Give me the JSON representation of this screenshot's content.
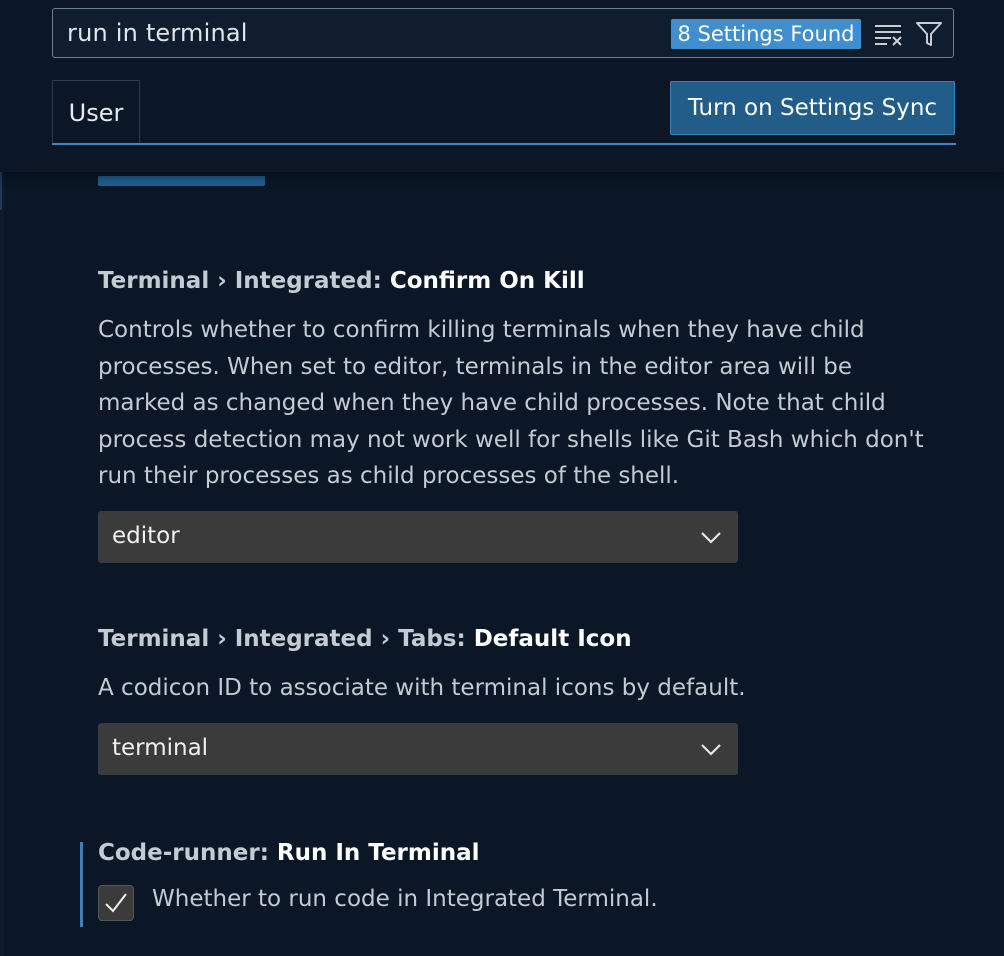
{
  "search": {
    "value": "run in terminal",
    "results_badge": "8 Settings Found"
  },
  "tabs": [
    {
      "label": "User",
      "active": true
    }
  ],
  "sync_button_label": "Turn on Settings Sync",
  "settings": [
    {
      "category": "Terminal › Integrated: ",
      "name": "Confirm On Kill",
      "description": "Controls whether to confirm killing terminals when they have child processes. When set to editor, terminals in the editor area will be marked as changed when they have child processes. Note that child process detection may not work well for shells like Git Bash which don't run their processes as child processes of the shell.",
      "control": "dropdown",
      "value": "editor"
    },
    {
      "category": "Terminal › Integrated › Tabs: ",
      "name": "Default Icon",
      "description": "A codicon ID to associate with terminal icons by default.",
      "control": "dropdown",
      "value": "terminal"
    },
    {
      "category": "Code-runner: ",
      "name": "Run In Terminal",
      "description": "Whether to run code in Integrated Terminal.",
      "control": "checkbox",
      "checked": true
    }
  ],
  "icons": {
    "clear": "clear-filter-icon",
    "filter": "filter-icon",
    "chevron": "chevron-down-icon",
    "check": "check-icon"
  },
  "colors": {
    "background": "#0b1727",
    "accent": "#3d86c7",
    "badge": "#3f8fd0",
    "sync_button": "#225d8a",
    "control_bg": "#3b3b3b"
  }
}
